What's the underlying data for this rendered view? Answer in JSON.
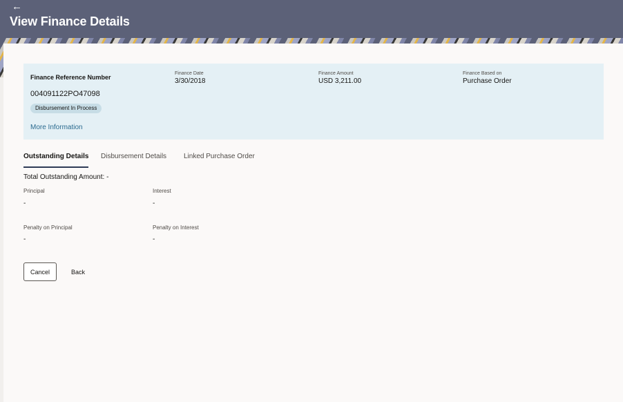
{
  "header": {
    "back_icon": "left-arrow-icon",
    "title": "View Finance Details"
  },
  "summary": {
    "reference_label": "Finance Reference Number",
    "reference_value": "004091122PO47098",
    "status": "Disbursement In Process",
    "more_info_link": "More Information",
    "finance_date_label": "Finance Date",
    "finance_date_value": "3/30/2018",
    "finance_amount_label": "Finance Amount",
    "finance_amount_value": "USD 3,211.00",
    "based_on_label": "Finance Based on",
    "based_on_value": "Purchase Order"
  },
  "tabs": [
    {
      "label": "Outstanding Details",
      "active": true
    },
    {
      "label": "Disbursement Details",
      "active": false
    },
    {
      "label": "Linked Purchase Order",
      "active": false
    }
  ],
  "outstanding": {
    "total_label": "Total Outstanding Amount:",
    "total_value": "-",
    "principal_label": "Principal",
    "principal_value": "-",
    "interest_label": "Interest",
    "interest_value": "-",
    "penalty_principal_label": "Penalty on Principal",
    "penalty_principal_value": "-",
    "penalty_interest_label": "Penalty on Interest",
    "penalty_interest_value": "-"
  },
  "actions": {
    "cancel_label": "Cancel",
    "back_label": "Back"
  },
  "colors": {
    "header_bg": "#5c6178",
    "summary_bg": "#e4f0f5",
    "link": "#2a6a8f",
    "page_bg": "#fbf9f8"
  }
}
